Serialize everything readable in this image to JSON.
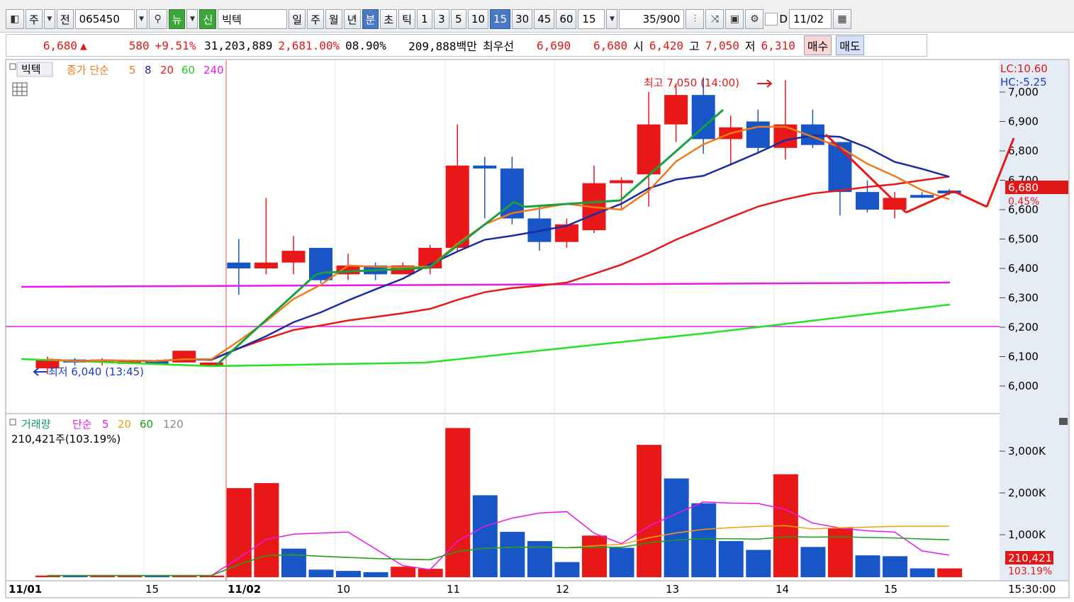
{
  "toolbar": {
    "type_label": "주",
    "mode_label": "전",
    "stock_code": "065450",
    "news_label": "뉴",
    "new_label": "신",
    "stock_name": "빅텍",
    "period_tabs": [
      "일",
      "주",
      "월",
      "년",
      "분",
      "초",
      "틱"
    ],
    "active_period": "분",
    "interval_tabs": [
      "1",
      "3",
      "5",
      "10",
      "15",
      "30",
      "45",
      "60"
    ],
    "active_interval": "15",
    "interval_value": "15",
    "count_value": "35",
    "count_max": "/900",
    "d_label": "D",
    "date_value": "11/02"
  },
  "quote": {
    "price": "6,680",
    "change_arrow": "▲",
    "change": "580",
    "change_pct": "+9.51%",
    "volume": "31,203,889",
    "vol_ratio": "2,681.00%",
    "turnover": "08.90%",
    "amount": "209,888백만",
    "best_label": "최우선",
    "ask": "6,690",
    "bid": "6,680",
    "open_label": "시",
    "open": "6,420",
    "high_label": "고",
    "high": "7,050",
    "low_label": "저",
    "low": "6,310",
    "buy_label": "매수",
    "sell_label": "매도"
  },
  "price_panel": {
    "name": "빅텍",
    "ma_label": "종가 단순",
    "ma_periods": [
      "5",
      "8",
      "20",
      "60",
      "240"
    ],
    "ma_colors": [
      "#f07a1a",
      "#1a2ca0",
      "#e81818",
      "#18d018",
      "#e818e8"
    ],
    "lc_label": "LC:10.60",
    "hc_label": "HC:-5.25",
    "high_note": "최고 7,050 (14:00)",
    "low_note": "최저 6,040 (13:45)",
    "current_price_tag": "6,680",
    "current_pct_tag": "0.45%"
  },
  "volume_panel": {
    "name": "거래량",
    "ma_label": "단순",
    "ma_periods": [
      "5",
      "20",
      "60",
      "120"
    ],
    "ma_colors": [
      "#e818e8",
      "#f0a010",
      "#18a018",
      "#888888"
    ],
    "current_volume": "210,421주(103.19%)",
    "volume_tag": "210,421",
    "volume_pct_tag": "103.19%"
  },
  "x_axis": {
    "labels": [
      "11/01",
      "15",
      "11/02",
      "10",
      "11",
      "12",
      "13",
      "14",
      "15"
    ],
    "time": "15:30:00"
  },
  "chart_data": {
    "type": "candlestick",
    "y_price_ticks": [
      "7,000",
      "6,900",
      "6,800",
      "6,700",
      "6,600",
      "6,500",
      "6,400",
      "6,300",
      "6,200",
      "6,100",
      "6,000"
    ],
    "y_volume_ticks": [
      "3,000K",
      "2,000K",
      "1,000K"
    ],
    "candles": [
      {
        "o": 6060,
        "h": 6100,
        "l": 6040,
        "c": 6090,
        "up": true
      },
      {
        "o": 6090,
        "h": 6095,
        "l": 6070,
        "c": 6080,
        "up": false
      },
      {
        "o": 6080,
        "h": 6095,
        "l": 6070,
        "c": 6090,
        "up": true
      },
      {
        "o": 6080,
        "h": 6090,
        "l": 6075,
        "c": 6085,
        "up": true
      },
      {
        "o": 6085,
        "h": 6090,
        "l": 6075,
        "c": 6080,
        "up": false
      },
      {
        "o": 6080,
        "h": 6120,
        "l": 6080,
        "c": 6120,
        "up": true
      },
      {
        "o": 6080,
        "h": 6080,
        "l": 6070,
        "c": 6080,
        "up": true
      },
      {
        "o": 6420,
        "h": 6500,
        "l": 6310,
        "c": 6400,
        "up": false
      },
      {
        "o": 6400,
        "h": 6640,
        "l": 6380,
        "c": 6420,
        "up": true
      },
      {
        "o": 6420,
        "h": 6510,
        "l": 6380,
        "c": 6460,
        "up": true
      },
      {
        "o": 6470,
        "h": 6470,
        "l": 6350,
        "c": 6360,
        "up": false
      },
      {
        "o": 6380,
        "h": 6450,
        "l": 6360,
        "c": 6410,
        "up": true
      },
      {
        "o": 6410,
        "h": 6420,
        "l": 6360,
        "c": 6380,
        "up": false
      },
      {
        "o": 6380,
        "h": 6420,
        "l": 6380,
        "c": 6410,
        "up": true
      },
      {
        "o": 6400,
        "h": 6480,
        "l": 6380,
        "c": 6470,
        "up": true
      },
      {
        "o": 6470,
        "h": 6890,
        "l": 6460,
        "c": 6750,
        "up": true
      },
      {
        "o": 6750,
        "h": 6780,
        "l": 6570,
        "c": 6740,
        "up": false
      },
      {
        "o": 6740,
        "h": 6780,
        "l": 6550,
        "c": 6570,
        "up": false
      },
      {
        "o": 6570,
        "h": 6610,
        "l": 6460,
        "c": 6490,
        "up": false
      },
      {
        "o": 6490,
        "h": 6570,
        "l": 6470,
        "c": 6550,
        "up": true
      },
      {
        "o": 6530,
        "h": 6750,
        "l": 6520,
        "c": 6690,
        "up": true
      },
      {
        "o": 6690,
        "h": 6710,
        "l": 6600,
        "c": 6700,
        "up": true
      },
      {
        "o": 6720,
        "h": 7000,
        "l": 6610,
        "c": 6890,
        "up": true
      },
      {
        "o": 6890,
        "h": 7030,
        "l": 6830,
        "c": 6990,
        "up": true
      },
      {
        "o": 6990,
        "h": 7050,
        "l": 6790,
        "c": 6840,
        "up": false
      },
      {
        "o": 6840,
        "h": 6920,
        "l": 6750,
        "c": 6880,
        "up": true
      },
      {
        "o": 6900,
        "h": 6940,
        "l": 6790,
        "c": 6810,
        "up": false
      },
      {
        "o": 6810,
        "h": 7040,
        "l": 6770,
        "c": 6890,
        "up": true
      },
      {
        "o": 6890,
        "h": 6940,
        "l": 6810,
        "c": 6820,
        "up": false
      },
      {
        "o": 6830,
        "h": 6830,
        "l": 6580,
        "c": 6660,
        "up": false
      },
      {
        "o": 6660,
        "h": 6700,
        "l": 6590,
        "c": 6600,
        "up": false
      },
      {
        "o": 6640,
        "h": 6660,
        "l": 6570,
        "c": 6600,
        "up": true
      },
      {
        "o": 6650,
        "h": 6660,
        "l": 6640,
        "c": 6650,
        "up": false
      },
      {
        "o": 6660,
        "h": 6670,
        "l": 6650,
        "c": 6665,
        "up": false
      }
    ],
    "volumes": [
      {
        "v": 40,
        "up": true
      },
      {
        "v": 40,
        "up": false
      },
      {
        "v": 40,
        "up": true
      },
      {
        "v": 40,
        "up": true
      },
      {
        "v": 40,
        "up": false
      },
      {
        "v": 40,
        "up": true
      },
      {
        "v": 40,
        "up": true
      },
      {
        "v": 2120,
        "up": true
      },
      {
        "v": 2240,
        "up": true
      },
      {
        "v": 680,
        "up": false
      },
      {
        "v": 180,
        "up": false
      },
      {
        "v": 150,
        "up": false
      },
      {
        "v": 120,
        "up": false
      },
      {
        "v": 250,
        "up": true
      },
      {
        "v": 200,
        "up": true
      },
      {
        "v": 3550,
        "up": true
      },
      {
        "v": 1950,
        "up": false
      },
      {
        "v": 1080,
        "up": false
      },
      {
        "v": 860,
        "up": false
      },
      {
        "v": 360,
        "up": false
      },
      {
        "v": 990,
        "up": true
      },
      {
        "v": 700,
        "up": false
      },
      {
        "v": 3150,
        "up": true
      },
      {
        "v": 2350,
        "up": false
      },
      {
        "v": 1760,
        "up": false
      },
      {
        "v": 860,
        "up": false
      },
      {
        "v": 650,
        "up": false
      },
      {
        "v": 2450,
        "up": true
      },
      {
        "v": 720,
        "up": false
      },
      {
        "v": 1180,
        "up": true
      },
      {
        "v": 520,
        "up": false
      },
      {
        "v": 500,
        "up": false
      },
      {
        "v": 210,
        "up": false
      },
      {
        "v": 210,
        "up": true
      }
    ]
  }
}
